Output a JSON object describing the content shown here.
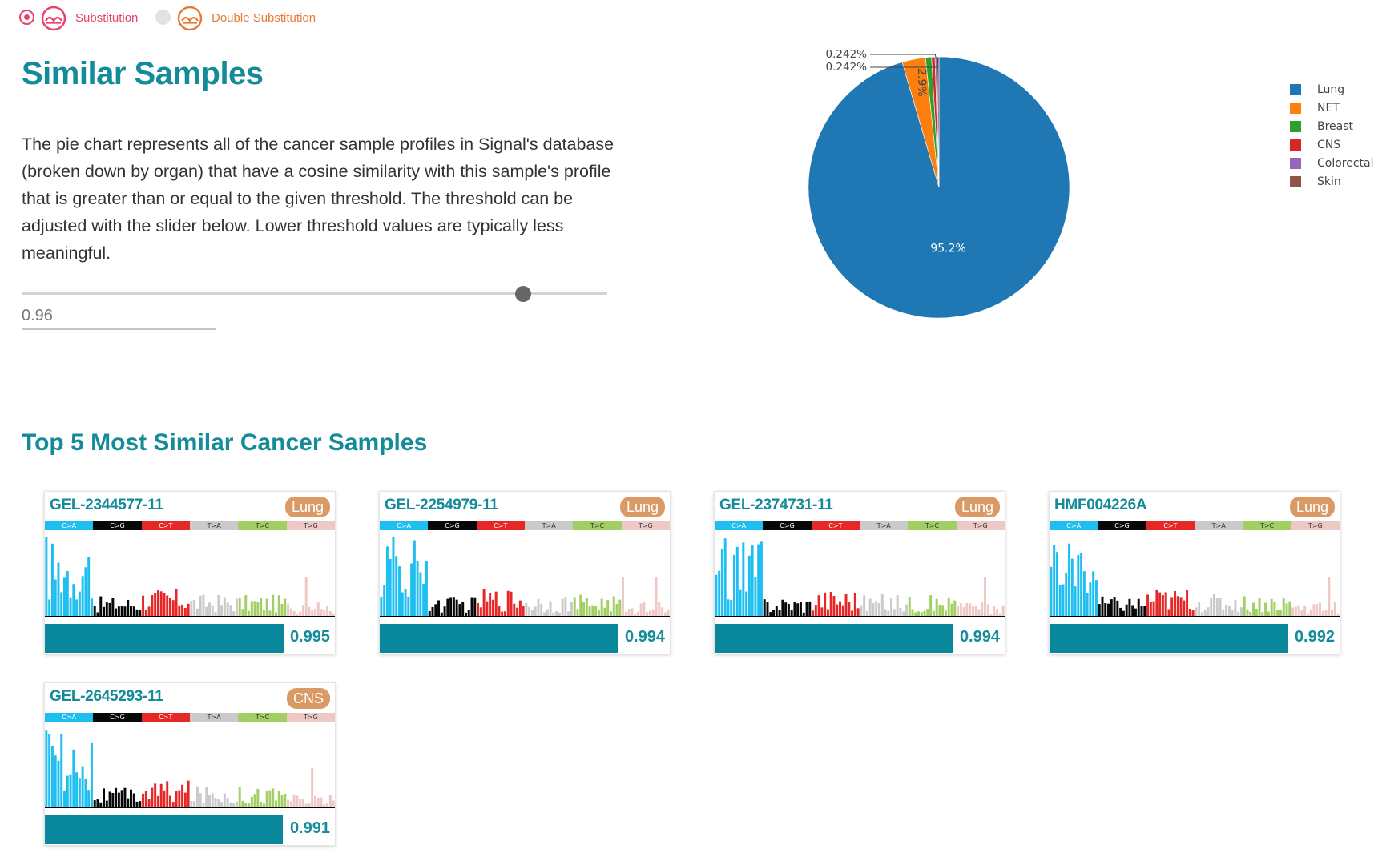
{
  "mutation_types": [
    {
      "name": "Substitution",
      "selected": true,
      "color": "#e8436b"
    },
    {
      "name": "Double Substitution",
      "selected": false,
      "color": "#e77c3a"
    }
  ],
  "title": "Similar Samples",
  "description": "The pie chart represents all of the cancer sample profiles in Signal's database (broken down by organ) that have a cosine similarity with this sample's profile that is greater than or equal to the given threshold. The threshold can be adjusted with the slider below. Lower threshold values are typically less meaningful.",
  "threshold": {
    "value": "0.96",
    "slider_fraction": 0.96
  },
  "chart_data": {
    "type": "pie",
    "slices": [
      {
        "label": "Lung",
        "value": 95.2,
        "text": "95.2%",
        "color": "#1f77b4"
      },
      {
        "label": "NET",
        "value": 2.9,
        "text": "2.9%",
        "color": "#ff7f0e"
      },
      {
        "label": "Breast",
        "value": 0.742,
        "text": "",
        "color": "#2ca02c"
      },
      {
        "label": "CNS",
        "value": 0.42,
        "text": "",
        "color": "#d62728"
      },
      {
        "label": "Colorectal",
        "value": 0.242,
        "text": "0.242%",
        "color": "#9467bd"
      },
      {
        "label": "Skin",
        "value": 0.242,
        "text": "0.242%",
        "color": "#8c564b"
      }
    ],
    "legend_position": "right"
  },
  "top_title": "Top 5 Most Similar Cancer Samples",
  "substitution_classes": [
    {
      "label": "C>A",
      "color": "#1ebff0",
      "text_color": "#ffffff"
    },
    {
      "label": "C>G",
      "color": "#050708",
      "text_color": "#ffffff"
    },
    {
      "label": "C>T",
      "color": "#e62725",
      "text_color": "#ffffff"
    },
    {
      "label": "T>A",
      "color": "#cbcacb",
      "text_color": "#333333"
    },
    {
      "label": "T>C",
      "color": "#a1cf64",
      "text_color": "#333333"
    },
    {
      "label": "T>G",
      "color": "#edc8c5",
      "text_color": "#333333"
    }
  ],
  "samples": [
    {
      "id": "GEL-2344577-11",
      "organ": "Lung",
      "score": 0.995,
      "score_text": "0.995"
    },
    {
      "id": "GEL-2254979-11",
      "organ": "Lung",
      "score": 0.994,
      "score_text": "0.994"
    },
    {
      "id": "GEL-2374731-11",
      "organ": "Lung",
      "score": 0.994,
      "score_text": "0.994"
    },
    {
      "id": "HMF004226A",
      "organ": "Lung",
      "score": 0.992,
      "score_text": "0.992"
    },
    {
      "id": "GEL-2645293-11",
      "organ": "CNS",
      "score": 0.991,
      "score_text": "0.991"
    }
  ]
}
